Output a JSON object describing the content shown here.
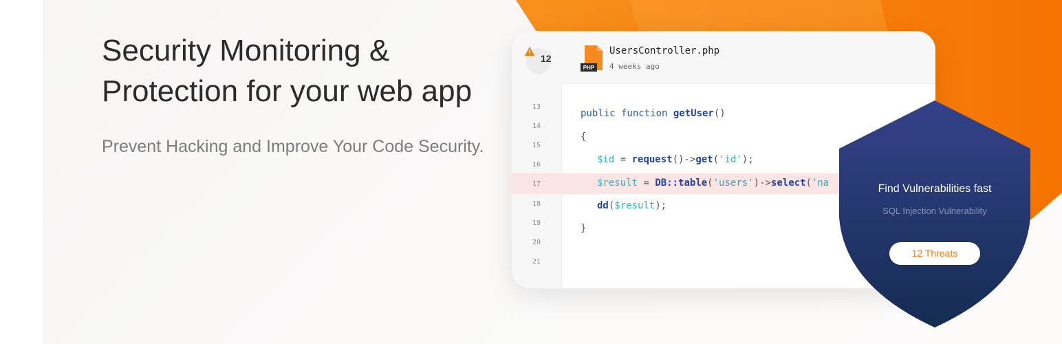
{
  "hero": {
    "title_line1": "Security Monitoring &",
    "title_line2": "Protection for your web app",
    "subtitle": "Prevent Hacking and Improve Your Code Security."
  },
  "code_card": {
    "threat_count": "12",
    "file": {
      "name": "UsersController.php",
      "modified": "4 weeks ago",
      "type_badge": "PHP"
    },
    "line_numbers": [
      "13",
      "14",
      "15",
      "16",
      "17",
      "18",
      "19",
      "20",
      "21"
    ],
    "highlighted_line": "17",
    "code": {
      "l13_kw": "public function ",
      "l13_fn": "getUser",
      "l13_rest": "()",
      "l14": "{",
      "l15_var": "$id",
      "l15_eq": " = ",
      "l15_fn": "request",
      "l15_p": "()->",
      "l15_get": "get",
      "l15_open": "(",
      "l15_str": "'id'",
      "l15_close": ");",
      "l16_var": "$result",
      "l16_eq": " = ",
      "l16_cls": "DB::table",
      "l16_open": "(",
      "l16_str": "'users'",
      "l16_arrow": ")->",
      "l16_sel": "select",
      "l16_open2": "(",
      "l16_str2": "'na",
      "l17_fn": "dd",
      "l17_open": "(",
      "l17_var": "$result",
      "l17_close": ");",
      "l18": "}"
    }
  },
  "shield": {
    "title": "Find Vulnerabilities fast",
    "subtitle": "SQL Injection Vulnerability",
    "button_label": "12 Threats"
  },
  "colors": {
    "accent_orange": "#f57c00",
    "shield_navy": "#2b3a75",
    "highlight_row": "#fbe4e4"
  }
}
